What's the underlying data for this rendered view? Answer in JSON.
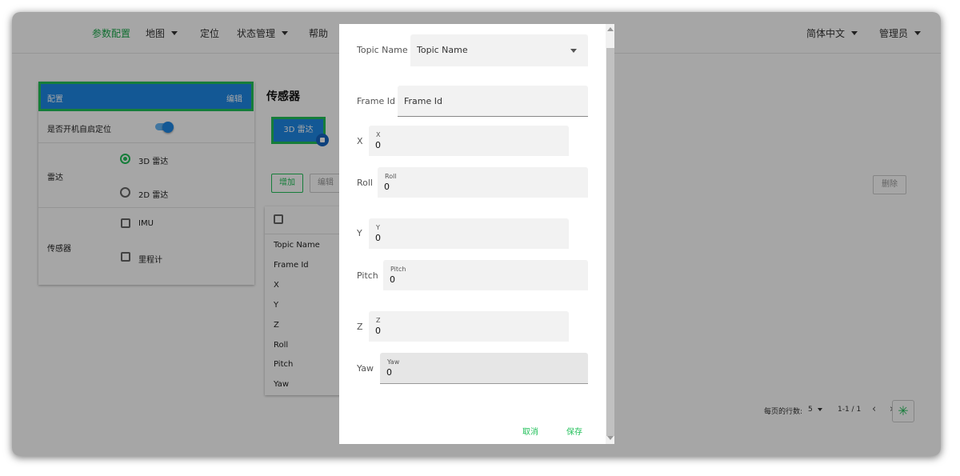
{
  "topnav": {
    "items": [
      {
        "label": "参数配置",
        "active": true
      },
      {
        "label": "地图",
        "dropdown": true
      },
      {
        "label": "定位"
      },
      {
        "label": "状态管理",
        "dropdown": true
      },
      {
        "label": "帮助"
      }
    ],
    "language": "简体中文",
    "user": "管理员"
  },
  "config_panel": {
    "header_title": "配置",
    "header_edit": "编辑",
    "auto_localize_label": "是否开机自启定位",
    "auto_localize_enabled": true,
    "lidar_label": "雷达",
    "lidar_options": [
      {
        "label": "3D 雷达",
        "selected": true
      },
      {
        "label": "2D 雷达",
        "selected": false
      }
    ],
    "sensor_label": "传感器",
    "sensor_options": [
      {
        "label": "IMU",
        "checked": false
      },
      {
        "label": "里程计",
        "checked": false
      }
    ]
  },
  "sensor_section": {
    "title": "传感器",
    "chip_label": "3D 雷达",
    "add_button": "增加",
    "edit_button": "编辑",
    "delete_button": "删除",
    "table_rows": [
      "Topic Name",
      "Frame Id",
      "X",
      "Y",
      "Z",
      "Roll",
      "Pitch",
      "Yaw"
    ]
  },
  "pagination": {
    "rows_per_page_label": "每页的行数:",
    "rows_per_page": "5",
    "range": "1-1 / 1"
  },
  "dialog": {
    "topic_name": {
      "label": "Topic Name",
      "value": "Topic Name"
    },
    "frame_id": {
      "label": "Frame Id",
      "placeholder": "Frame Id"
    },
    "x": {
      "label": "X",
      "small": "X",
      "value": "0"
    },
    "roll": {
      "label": "Roll",
      "small": "Roll",
      "value": "0"
    },
    "y": {
      "label": "Y",
      "small": "Y",
      "value": "0"
    },
    "pitch": {
      "label": "Pitch",
      "small": "Pitch",
      "value": "0"
    },
    "z": {
      "label": "Z",
      "small": "Z",
      "value": "0"
    },
    "yaw": {
      "label": "Yaw",
      "small": "Yaw",
      "value": "0"
    },
    "cancel_button": "取消",
    "save_button": "保存"
  },
  "colors": {
    "accent_green": "#22c05a",
    "primary_blue": "#1e88e5"
  }
}
